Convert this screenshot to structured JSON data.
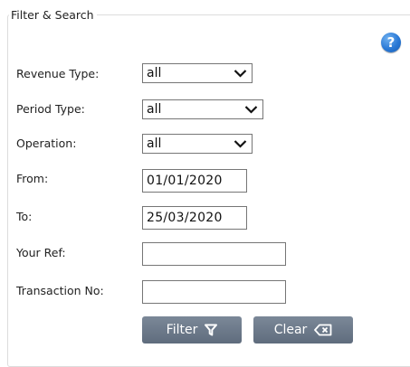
{
  "panel": {
    "legend": "Filter & Search"
  },
  "help": {
    "glyph": "?"
  },
  "fields": {
    "revenue_type": {
      "label": "Revenue Type:",
      "value": "all"
    },
    "period_type": {
      "label": "Period Type:",
      "value": "all"
    },
    "operation": {
      "label": "Operation:",
      "value": "all"
    },
    "from": {
      "label": "From:",
      "value": "01/01/2020"
    },
    "to": {
      "label": "To:",
      "value": "25/03/2020"
    },
    "your_ref": {
      "label": "Your Ref:",
      "value": ""
    },
    "transaction_no": {
      "label": "Transaction No:",
      "value": ""
    }
  },
  "buttons": {
    "filter": {
      "label": "Filter",
      "icon": "funnel-icon"
    },
    "clear": {
      "label": "Clear",
      "icon": "backspace-icon"
    }
  },
  "colors": {
    "button_bg": "#6b7787",
    "help_blue": "#2a79d6",
    "border": "#767676"
  }
}
